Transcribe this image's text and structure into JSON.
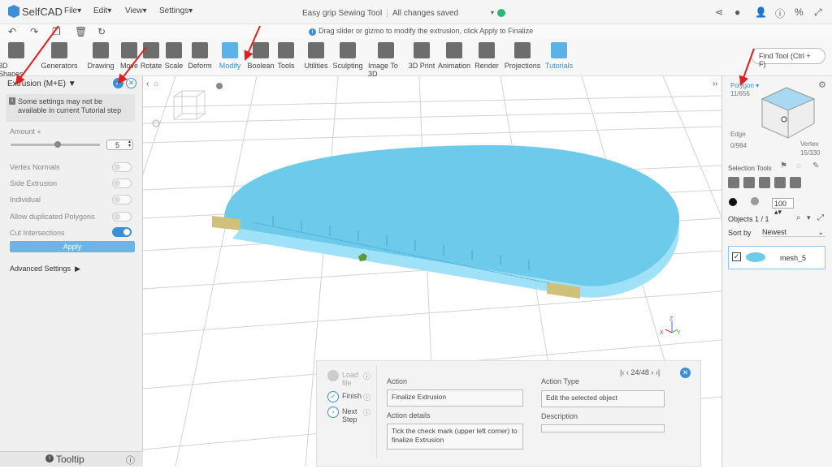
{
  "app": {
    "name": "SelfCAD",
    "title": "Easy grip Sewing Tool",
    "save_status": "All changes saved"
  },
  "menu": {
    "file": "File",
    "edit": "Edit",
    "view": "View",
    "settings": "Settings"
  },
  "hint": "Drag slider or gizmo to modify the extrusion, click Apply to Finalize",
  "toolbar": [
    {
      "label": "3D Shapes",
      "icon": "cube-icon"
    },
    {
      "label": "Generators",
      "icon": "generator-icon"
    },
    {
      "label": "Drawing",
      "icon": "pen-icon"
    },
    {
      "label": "Move",
      "icon": "move-icon"
    },
    {
      "label": "Rotate",
      "icon": "rotate-icon"
    },
    {
      "label": "Scale",
      "icon": "scale-icon"
    },
    {
      "label": "Deform",
      "icon": "deform-icon"
    },
    {
      "label": "Modify",
      "icon": "modify-icon"
    },
    {
      "label": "Boolean",
      "icon": "boolean-icon"
    },
    {
      "label": "Tools",
      "icon": "tools-icon"
    },
    {
      "label": "Utilities",
      "icon": "utilities-icon"
    },
    {
      "label": "Sculpting",
      "icon": "sculpt-icon"
    },
    {
      "label": "Image To 3D",
      "icon": "image-icon"
    },
    {
      "label": "3D Print",
      "icon": "printer-icon"
    },
    {
      "label": "Animation",
      "icon": "animation-icon"
    },
    {
      "label": "Render",
      "icon": "render-icon"
    },
    {
      "label": "Projections",
      "icon": "projection-icon"
    },
    {
      "label": "Tutorials",
      "icon": "tutorial-icon"
    }
  ],
  "find_tool": "Find Tool (Ctrl + F)",
  "left_panel": {
    "header": "Extrusion (M+E)",
    "warning": "Some settings may not be available in current Tutorial step",
    "amount_label": "Amount",
    "amount_value": "5",
    "vertex_normals": "Vertex Normals",
    "side_extrusion": "Side Extrusion",
    "individual": "Individual",
    "allow_dup": "Allow duplicated Polygons",
    "cut_intersections": "Cut Intersections",
    "apply": "Apply",
    "advanced": "Advanced Settings",
    "tooltip": "Tooltip"
  },
  "right_panel": {
    "polygon": "Polygon",
    "polygon_count": "11/656",
    "edge": "Edge",
    "edge_count": "0/984",
    "vertex": "Vertex",
    "vertex_count": "15/330",
    "selection_tools": "Selection Tools",
    "percent": "100",
    "objects": "Objects 1 / 1",
    "sort_by": "Sort by",
    "sort_value": "Newest",
    "object_name": "mesh_5"
  },
  "tutorial": {
    "load_file": "Load file",
    "finish": "Finish",
    "next_step": "Next Step",
    "action_label": "Action",
    "action_value": "Finalize Extrusion",
    "action_details_label": "Action details",
    "action_details_value": "Tick the check mark (upper left corner) to finalize Extrusion",
    "action_type_label": "Action Type",
    "action_type_value": "Edit the selected object",
    "description_label": "Description",
    "description_value": "",
    "pager": "24/48"
  },
  "colors": {
    "accent": "#3a8fd8",
    "mesh": "#6ccbeb",
    "arrow": "#e02020"
  }
}
